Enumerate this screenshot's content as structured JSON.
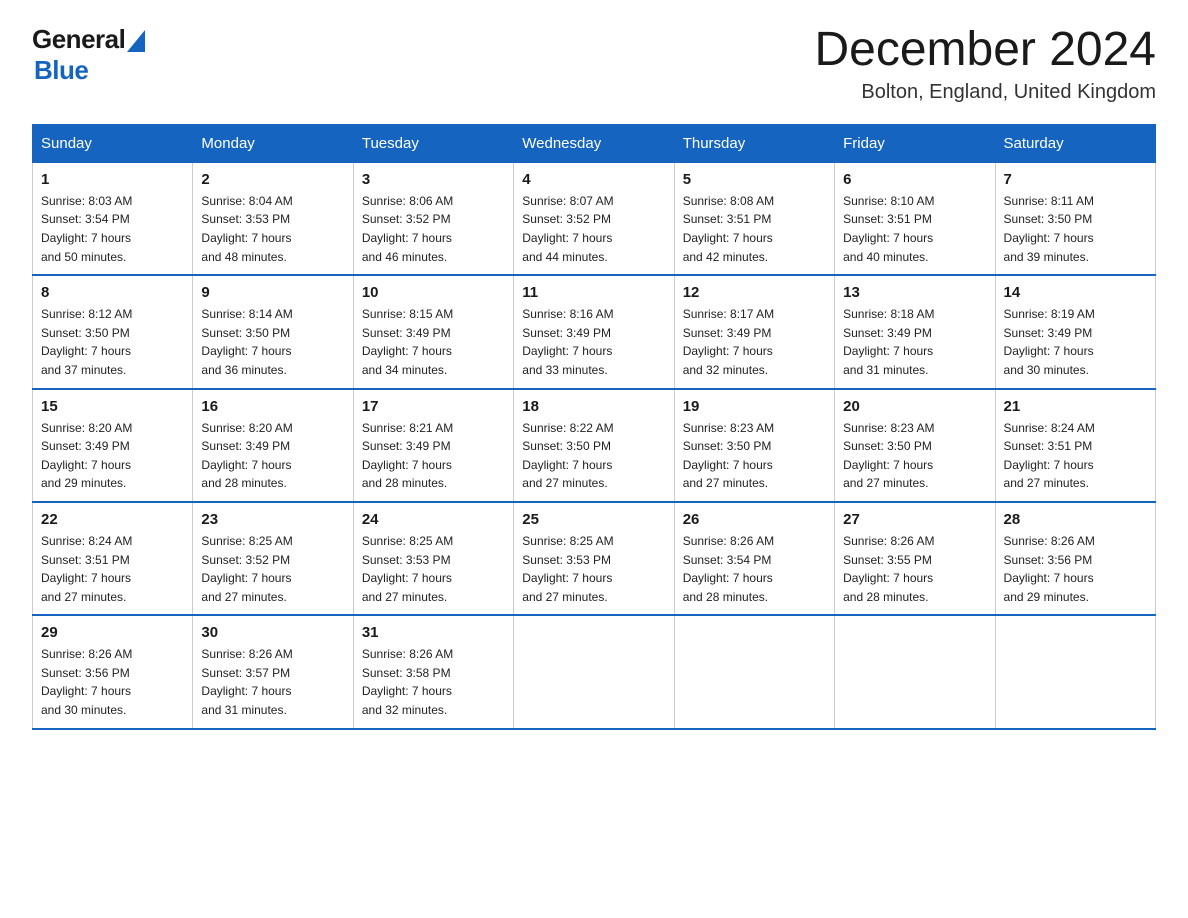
{
  "header": {
    "logo_general": "General",
    "logo_blue": "Blue",
    "month_title": "December 2024",
    "location": "Bolton, England, United Kingdom"
  },
  "days_of_week": [
    "Sunday",
    "Monday",
    "Tuesday",
    "Wednesday",
    "Thursday",
    "Friday",
    "Saturday"
  ],
  "weeks": [
    [
      {
        "day": "1",
        "sunrise": "8:03 AM",
        "sunset": "3:54 PM",
        "daylight": "7 hours and 50 minutes."
      },
      {
        "day": "2",
        "sunrise": "8:04 AM",
        "sunset": "3:53 PM",
        "daylight": "7 hours and 48 minutes."
      },
      {
        "day": "3",
        "sunrise": "8:06 AM",
        "sunset": "3:52 PM",
        "daylight": "7 hours and 46 minutes."
      },
      {
        "day": "4",
        "sunrise": "8:07 AM",
        "sunset": "3:52 PM",
        "daylight": "7 hours and 44 minutes."
      },
      {
        "day": "5",
        "sunrise": "8:08 AM",
        "sunset": "3:51 PM",
        "daylight": "7 hours and 42 minutes."
      },
      {
        "day": "6",
        "sunrise": "8:10 AM",
        "sunset": "3:51 PM",
        "daylight": "7 hours and 40 minutes."
      },
      {
        "day": "7",
        "sunrise": "8:11 AM",
        "sunset": "3:50 PM",
        "daylight": "7 hours and 39 minutes."
      }
    ],
    [
      {
        "day": "8",
        "sunrise": "8:12 AM",
        "sunset": "3:50 PM",
        "daylight": "7 hours and 37 minutes."
      },
      {
        "day": "9",
        "sunrise": "8:14 AM",
        "sunset": "3:50 PM",
        "daylight": "7 hours and 36 minutes."
      },
      {
        "day": "10",
        "sunrise": "8:15 AM",
        "sunset": "3:49 PM",
        "daylight": "7 hours and 34 minutes."
      },
      {
        "day": "11",
        "sunrise": "8:16 AM",
        "sunset": "3:49 PM",
        "daylight": "7 hours and 33 minutes."
      },
      {
        "day": "12",
        "sunrise": "8:17 AM",
        "sunset": "3:49 PM",
        "daylight": "7 hours and 32 minutes."
      },
      {
        "day": "13",
        "sunrise": "8:18 AM",
        "sunset": "3:49 PM",
        "daylight": "7 hours and 31 minutes."
      },
      {
        "day": "14",
        "sunrise": "8:19 AM",
        "sunset": "3:49 PM",
        "daylight": "7 hours and 30 minutes."
      }
    ],
    [
      {
        "day": "15",
        "sunrise": "8:20 AM",
        "sunset": "3:49 PM",
        "daylight": "7 hours and 29 minutes."
      },
      {
        "day": "16",
        "sunrise": "8:20 AM",
        "sunset": "3:49 PM",
        "daylight": "7 hours and 28 minutes."
      },
      {
        "day": "17",
        "sunrise": "8:21 AM",
        "sunset": "3:49 PM",
        "daylight": "7 hours and 28 minutes."
      },
      {
        "day": "18",
        "sunrise": "8:22 AM",
        "sunset": "3:50 PM",
        "daylight": "7 hours and 27 minutes."
      },
      {
        "day": "19",
        "sunrise": "8:23 AM",
        "sunset": "3:50 PM",
        "daylight": "7 hours and 27 minutes."
      },
      {
        "day": "20",
        "sunrise": "8:23 AM",
        "sunset": "3:50 PM",
        "daylight": "7 hours and 27 minutes."
      },
      {
        "day": "21",
        "sunrise": "8:24 AM",
        "sunset": "3:51 PM",
        "daylight": "7 hours and 27 minutes."
      }
    ],
    [
      {
        "day": "22",
        "sunrise": "8:24 AM",
        "sunset": "3:51 PM",
        "daylight": "7 hours and 27 minutes."
      },
      {
        "day": "23",
        "sunrise": "8:25 AM",
        "sunset": "3:52 PM",
        "daylight": "7 hours and 27 minutes."
      },
      {
        "day": "24",
        "sunrise": "8:25 AM",
        "sunset": "3:53 PM",
        "daylight": "7 hours and 27 minutes."
      },
      {
        "day": "25",
        "sunrise": "8:25 AM",
        "sunset": "3:53 PM",
        "daylight": "7 hours and 27 minutes."
      },
      {
        "day": "26",
        "sunrise": "8:26 AM",
        "sunset": "3:54 PM",
        "daylight": "7 hours and 28 minutes."
      },
      {
        "day": "27",
        "sunrise": "8:26 AM",
        "sunset": "3:55 PM",
        "daylight": "7 hours and 28 minutes."
      },
      {
        "day": "28",
        "sunrise": "8:26 AM",
        "sunset": "3:56 PM",
        "daylight": "7 hours and 29 minutes."
      }
    ],
    [
      {
        "day": "29",
        "sunrise": "8:26 AM",
        "sunset": "3:56 PM",
        "daylight": "7 hours and 30 minutes."
      },
      {
        "day": "30",
        "sunrise": "8:26 AM",
        "sunset": "3:57 PM",
        "daylight": "7 hours and 31 minutes."
      },
      {
        "day": "31",
        "sunrise": "8:26 AM",
        "sunset": "3:58 PM",
        "daylight": "7 hours and 32 minutes."
      },
      null,
      null,
      null,
      null
    ]
  ],
  "labels": {
    "sunrise": "Sunrise:",
    "sunset": "Sunset:",
    "daylight": "Daylight:"
  }
}
